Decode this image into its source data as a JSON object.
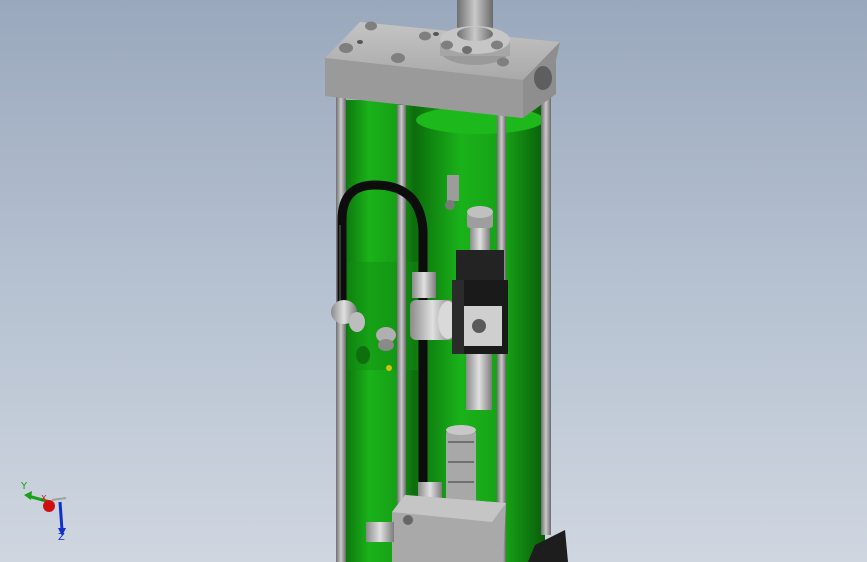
{
  "viewport": {
    "background_top": "#9aa8bd",
    "background_bottom": "#cfd6e0"
  },
  "model": {
    "cylinder_color": "#12a012",
    "frame_color": "#8c8c8c",
    "hose_color": "#111111"
  },
  "triad": {
    "x_label": "X",
    "y_label": "Y",
    "z_label": "Z",
    "x_color": "#d01010",
    "y_color": "#18a018",
    "z_color": "#1030c8"
  }
}
